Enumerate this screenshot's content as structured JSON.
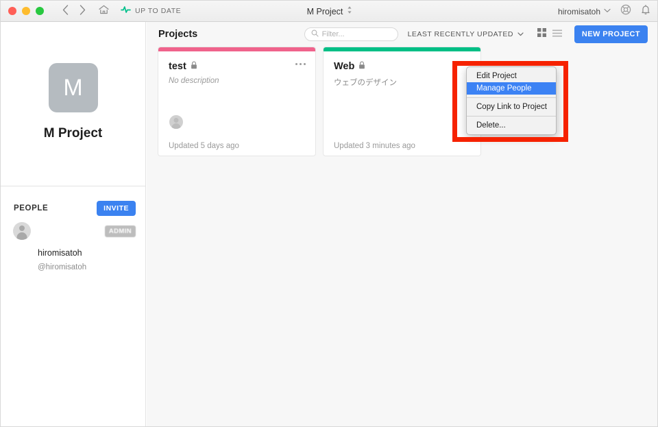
{
  "titlebar": {
    "traffic": [
      "close",
      "minimize",
      "zoom"
    ],
    "back_icon": "chevron-left-icon",
    "forward_icon": "chevron-right-icon",
    "home_icon": "home-icon",
    "status_icon": "pulse-icon",
    "status_label": "UP TO DATE",
    "center_title": "M Project",
    "center_switcher_icon": "up-down-chevron-icon",
    "user_name": "hiromisatoh",
    "user_caret": "chevron-down-icon",
    "help_icon": "life-ring-icon",
    "bell_icon": "bell-icon",
    "colors": {
      "status_green": "#00c08b",
      "accent_blue": "#3b82f0"
    }
  },
  "sidebar": {
    "project_initial": "M",
    "project_name": "M Project",
    "people_heading": "PEOPLE",
    "invite_label": "INVITE",
    "people": [
      {
        "name": "",
        "handle": "",
        "badge": "ADMIN",
        "avatar": "ghost-avatar",
        "redacted": true
      },
      {
        "name": "hiromisatoh",
        "handle": "@hiromisatoh",
        "badge": "",
        "avatar": "photo-avatar",
        "redacted": false
      }
    ]
  },
  "toolbar": {
    "page_title": "Projects",
    "filter_icon": "search-icon",
    "filter_value": "",
    "filter_placeholder": "Filter...",
    "sort_label": "LEAST RECENTLY UPDATED",
    "sort_caret": "chevron-down-icon",
    "grid_view_icon": "grid-view-icon",
    "list_view_icon": "list-view-icon",
    "new_project_label": "NEW PROJECT"
  },
  "cards": [
    {
      "title": "test",
      "lock_icon": "lock-icon",
      "description": "No description",
      "description_italic": true,
      "updated": "Updated 5 days ago",
      "bar_color": "#f0638c",
      "menu_icon": "ellipsis-icon",
      "avatars": [
        "ghost-avatar",
        "photo-avatar"
      ]
    },
    {
      "title": "Web",
      "lock_icon": "lock-icon",
      "description": "ウェブのデザイン",
      "description_italic": false,
      "updated": "Updated 3 minutes ago",
      "bar_color": "#00bf86",
      "menu_icon": "ellipsis-icon",
      "avatars": [
        "photo-avatar"
      ]
    }
  ],
  "context_menu": {
    "items": [
      {
        "label": "Edit Project",
        "selected": false
      },
      {
        "label": "Manage People",
        "selected": true
      },
      {
        "label": "Copy Link to Project",
        "selected": false
      },
      {
        "label": "Delete...",
        "selected": false
      }
    ],
    "selected_color": "#3c82f4"
  },
  "annotation": {
    "highlight_color": "#f62200"
  }
}
